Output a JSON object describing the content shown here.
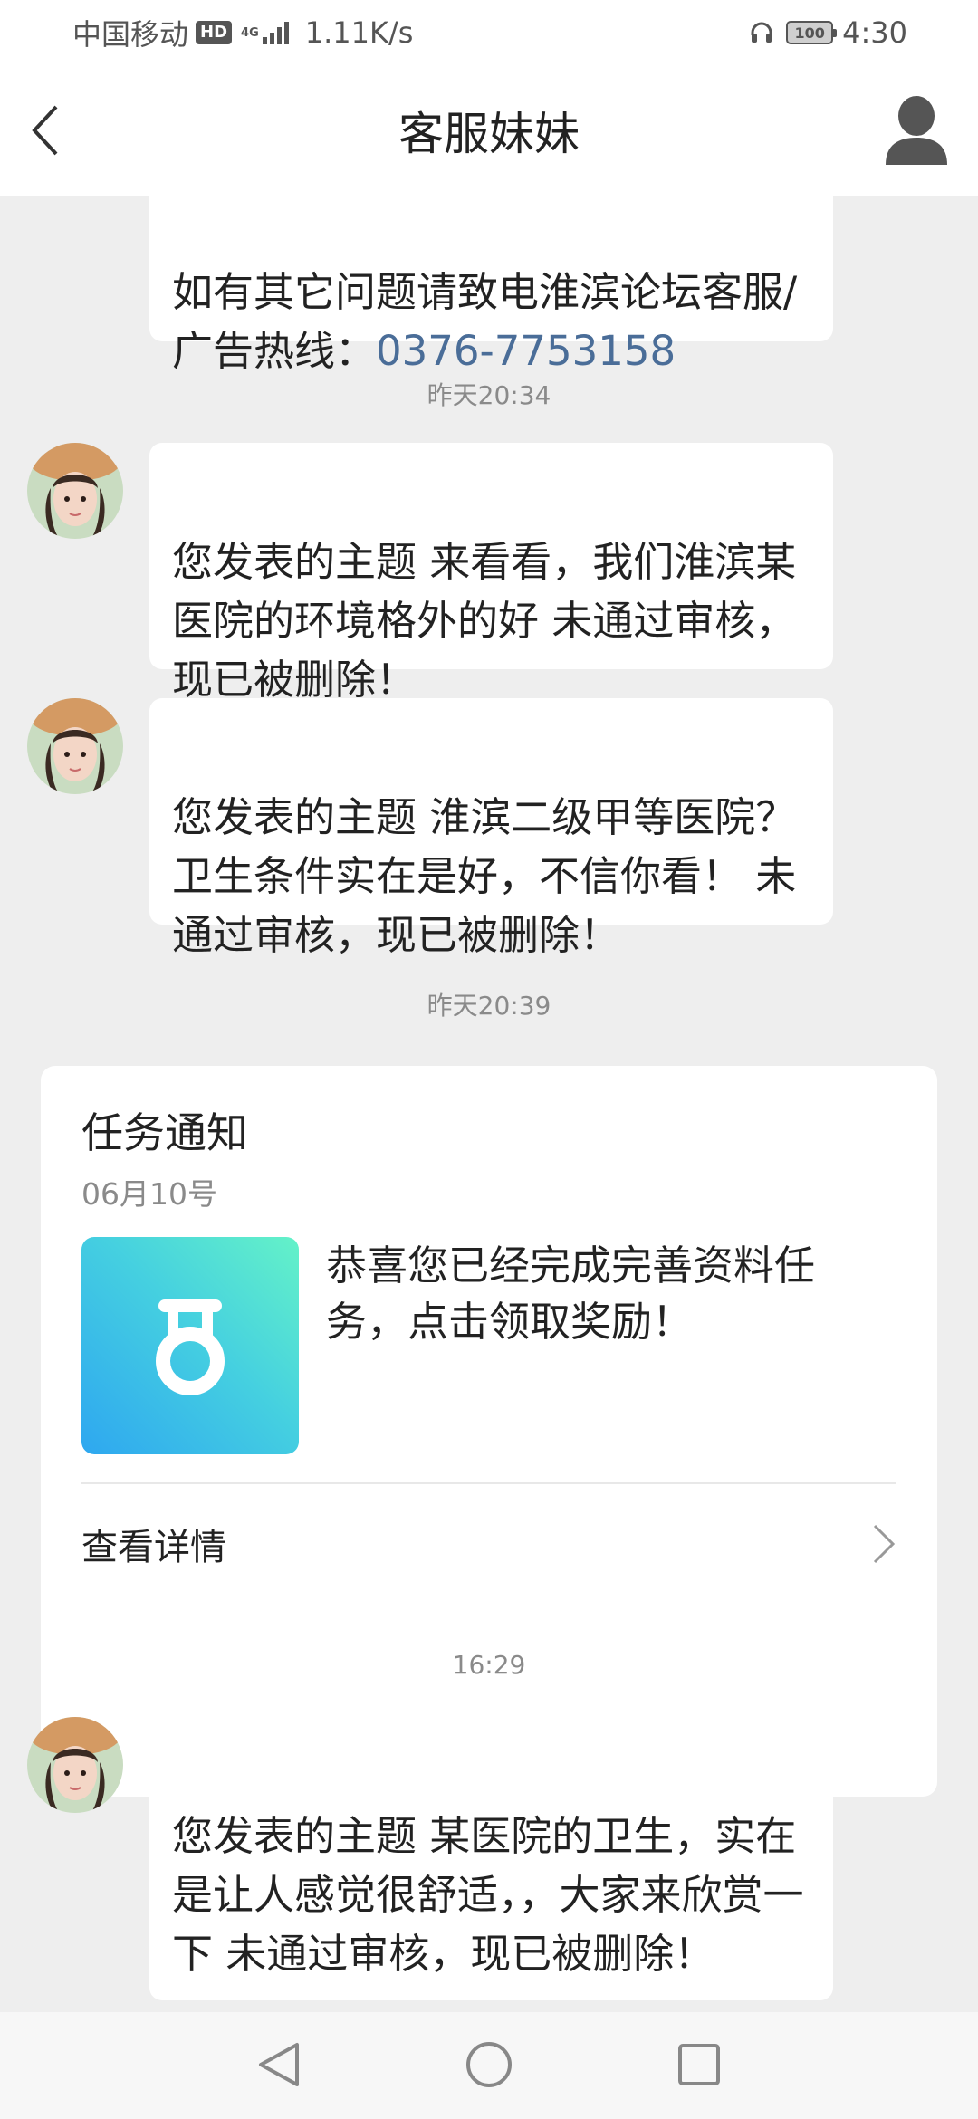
{
  "status_bar": {
    "carrier": "中国移动",
    "hd": "HD",
    "network": "4G",
    "speed": "1.11K/s",
    "battery": "100",
    "time": "4:30"
  },
  "header": {
    "title": "客服妹妹",
    "back_icon": "chevron-left-icon",
    "profile_icon": "person-icon"
  },
  "messages": [
    {
      "text_prefix": "如有其它问题请致电淮滨论坛客服/广告热线：",
      "phone": "0376-7753158"
    },
    {
      "timestamp": "昨天20:34"
    },
    {
      "text": "您发表的主题 来看看，我们淮滨某医院的环境格外的好 未通过审核，现已被删除！"
    },
    {
      "text": "您发表的主题 淮滨二级甲等医院？卫生条件实在是好，不信你看！ 未通过审核，现已被删除！"
    },
    {
      "timestamp": "昨天20:39"
    },
    {
      "text": "您发表的主题 某医院的卫生，实在是让人感觉很舒适，，大家来欣赏一下 未通过审核，现已被删除！"
    }
  ],
  "task_card": {
    "title": "任务通知",
    "date": "06月10号",
    "image_icon": "medal-icon",
    "text": "恭喜您已经完成完善资料任务，点击领取奖励！",
    "details_label": "查看详情"
  },
  "timestamp_3": "16:29",
  "colors": {
    "link": "#4a6d98",
    "background": "#eeeeee",
    "card_gradient_start": "#2ea7f0",
    "card_gradient_end": "#64f2c8"
  },
  "nav": {
    "back": "triangle-back-icon",
    "home": "circle-home-icon",
    "recents": "square-recents-icon"
  }
}
